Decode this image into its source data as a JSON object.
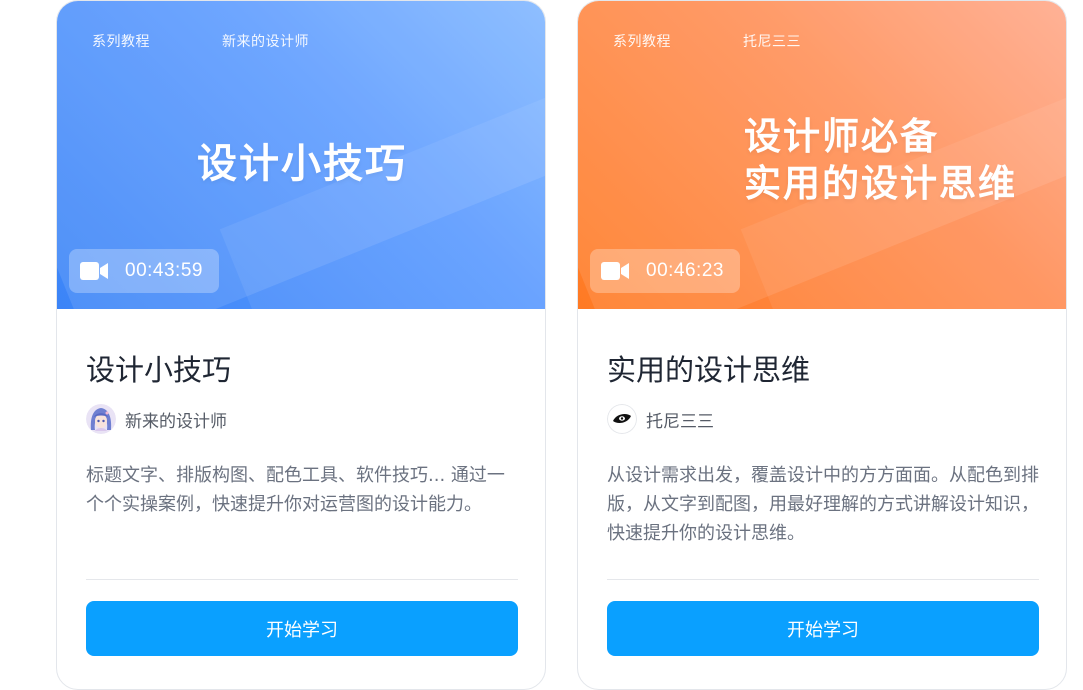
{
  "cards": [
    {
      "series_tag": "系列教程",
      "author_tag": "新来的设计师",
      "cover_title_lines": [
        "设计小技巧"
      ],
      "duration": "00:43:59",
      "title": "设计小技巧",
      "author": "新来的设计师",
      "description": "标题文字、排版构图、配色工具、软件技巧... 通过一个个实操案例，快速提升你对运营图的设计能力。",
      "button_label": "开始学习",
      "theme_color": "#4a8ff7",
      "avatar_icon": "anime-character-avatar"
    },
    {
      "series_tag": "系列教程",
      "author_tag": "托尼三三",
      "cover_title_lines": [
        "设计师必备",
        "实用的设计思维"
      ],
      "duration": "00:46:23",
      "title": "实用的设计思维",
      "author": "托尼三三",
      "description": "从设计需求出发，覆盖设计中的方方面面。从配色到排版，从文字到配图，用最好理解的方式讲解设计知识，快速提升你的设计思维。",
      "button_label": "开始学习",
      "theme_color": "#ff8a3d",
      "avatar_icon": "eye-logo-avatar"
    }
  ],
  "colors": {
    "button": "#0aa0ff",
    "title_text": "#1f2633",
    "description_text": "#6b7280"
  },
  "icons": {
    "duration": "video-camera-icon"
  }
}
